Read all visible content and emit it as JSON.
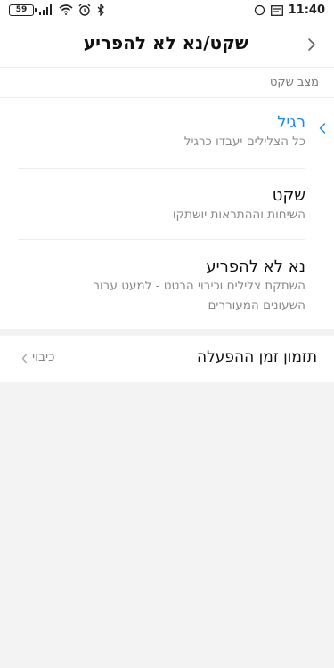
{
  "status_bar": {
    "battery": "59",
    "time": "11:40"
  },
  "header": {
    "title": "שקט/נא לא להפריע"
  },
  "section": {
    "label": "מצב שקט"
  },
  "options": [
    {
      "title": "רגיל",
      "description": "כל הצלילים יעבדו כרגיל",
      "selected": true
    },
    {
      "title": "שקט",
      "description": "השיחות וההתראות יושתקו",
      "selected": false
    },
    {
      "title": "נא לא להפריע",
      "description": "השתקת צלילים וכיבוי הרטט - למעט עבור השעונים המעוררים",
      "selected": false
    }
  ],
  "schedule": {
    "title": "תזמון זמן ההפעלה",
    "value": "כיבוי"
  },
  "colors": {
    "accent": "#1a8ee8",
    "background": "#f3f3f3"
  }
}
